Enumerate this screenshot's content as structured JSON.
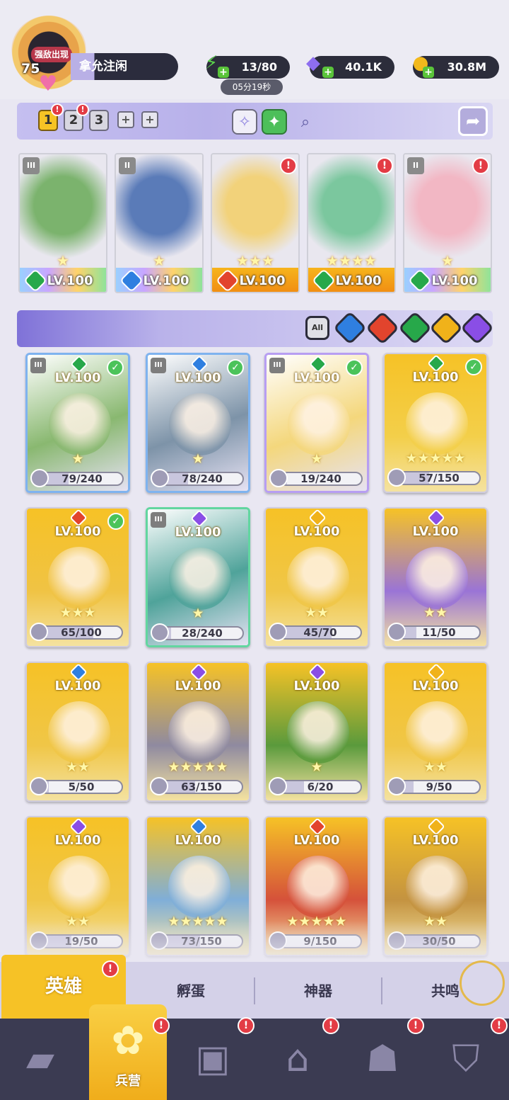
{
  "colors": {
    "nature": "#27a84a",
    "water": "#2f7fe0",
    "fire": "#e2442d",
    "light": "#f0b21a",
    "dark": "#8a4ee6",
    "gold_card": "#f6c226",
    "accent_purple": "#8e83e0"
  },
  "header": {
    "player": {
      "level": "75",
      "alert": "强敌出现",
      "name": "拿允注闲"
    },
    "energy": {
      "icon": "lightning-icon",
      "value": "13/80",
      "timer": "05分19秒"
    },
    "gems": {
      "icon": "diamond-icon",
      "value": "40.1K"
    },
    "coins": {
      "icon": "coin-icon",
      "value": "30.8M"
    }
  },
  "team_bar": {
    "tabs": [
      {
        "label": "1",
        "active": true,
        "alert": "!"
      },
      {
        "label": "2",
        "active": false,
        "alert": "!"
      },
      {
        "label": "3",
        "active": false,
        "alert": ""
      }
    ],
    "add_labels": [
      "+",
      "+"
    ]
  },
  "team": [
    {
      "rank": "III",
      "level": "LV.100",
      "element": "nature",
      "stars": "★",
      "band": "rainbow",
      "art": "#7bb36d",
      "alert": ""
    },
    {
      "rank": "II",
      "level": "LV.100",
      "element": "water",
      "stars": "★",
      "band": "rainbow",
      "art": "#5a7bb8",
      "alert": ""
    },
    {
      "rank": "",
      "level": "LV.100",
      "element": "fire",
      "stars": "★★★",
      "band": "gold",
      "art": "#f2d27a",
      "alert": "!"
    },
    {
      "rank": "",
      "level": "LV.100",
      "element": "nature",
      "stars": "★★★★",
      "band": "gold",
      "art": "#7bc79e",
      "alert": "!"
    },
    {
      "rank": "II",
      "level": "LV.100",
      "element": "nature",
      "stars": "★",
      "band": "rainbow",
      "art": "#f2b7c4",
      "alert": "!"
    }
  ],
  "filters": {
    "all_label": "All",
    "elements": [
      "water",
      "fire",
      "nature",
      "light",
      "dark"
    ]
  },
  "heroes": [
    {
      "rank": "III",
      "level": "LV.100",
      "element": "nature",
      "stars": "★",
      "frag_value": 79,
      "frag_max": 240,
      "fragments": "79/240",
      "owned": "blue",
      "check": true,
      "art": "#89b870"
    },
    {
      "rank": "III",
      "level": "LV.100",
      "element": "water",
      "stars": "★",
      "frag_value": 78,
      "frag_max": 240,
      "fragments": "78/240",
      "owned": "blue",
      "check": true,
      "art": "#7d93a8"
    },
    {
      "rank": "III",
      "level": "LV.100",
      "element": "nature",
      "stars": "★",
      "frag_value": 19,
      "frag_max": 240,
      "fragments": "19/240",
      "owned": "purple",
      "check": true,
      "art": "#f4d77c"
    },
    {
      "rank": "",
      "level": "LV.100",
      "element": "nature",
      "stars": "★★★★★",
      "frag_value": 57,
      "frag_max": 150,
      "fragments": "57/150",
      "owned": "",
      "check": true,
      "art": "#f3cf4a"
    },
    {
      "rank": "",
      "level": "LV.100",
      "element": "fire",
      "stars": "★★★",
      "frag_value": 65,
      "frag_max": 100,
      "fragments": "65/100",
      "owned": "",
      "check": true,
      "art": "#f0c344"
    },
    {
      "rank": "III",
      "level": "LV.100",
      "element": "dark",
      "stars": "★",
      "frag_value": 28,
      "frag_max": 240,
      "fragments": "28/240",
      "owned": "green",
      "check": false,
      "art": "#4fa39a"
    },
    {
      "rank": "",
      "level": "LV.100",
      "element": "light",
      "stars": "★★",
      "frag_value": 45,
      "frag_max": 70,
      "fragments": "45/70",
      "owned": "",
      "check": false,
      "art": "#f0c647"
    },
    {
      "rank": "",
      "level": "LV.100",
      "element": "dark",
      "stars": "★★",
      "frag_value": 11,
      "frag_max": 50,
      "fragments": "11/50",
      "owned": "",
      "check": false,
      "art": "#9a74d6"
    },
    {
      "rank": "",
      "level": "LV.100",
      "element": "water",
      "stars": "★★",
      "frag_value": 5,
      "frag_max": 50,
      "fragments": "5/50",
      "owned": "",
      "check": false,
      "art": "#f0c647"
    },
    {
      "rank": "",
      "level": "LV.100",
      "element": "dark",
      "stars": "★★★★★",
      "frag_value": 63,
      "frag_max": 150,
      "fragments": "63/150",
      "owned": "",
      "check": false,
      "art": "#8f8aa0"
    },
    {
      "rank": "",
      "level": "LV.100",
      "element": "dark",
      "stars": "★",
      "frag_value": 6,
      "frag_max": 20,
      "fragments": "6/20",
      "owned": "",
      "check": false,
      "art": "#5a9a3c"
    },
    {
      "rank": "",
      "level": "LV.100",
      "element": "light",
      "stars": "★★",
      "frag_value": 9,
      "frag_max": 50,
      "fragments": "9/50",
      "owned": "",
      "check": false,
      "art": "#f0c647"
    },
    {
      "rank": "",
      "level": "LV.100",
      "element": "dark",
      "stars": "★★",
      "frag_value": 19,
      "frag_max": 50,
      "fragments": "19/50",
      "owned": "",
      "check": false,
      "art": "#f0c647"
    },
    {
      "rank": "",
      "level": "LV.100",
      "element": "water",
      "stars": "★★★★★",
      "frag_value": 73,
      "frag_max": 150,
      "fragments": "73/150",
      "owned": "",
      "check": false,
      "art": "#7faed8"
    },
    {
      "rank": "",
      "level": "LV.100",
      "element": "fire",
      "stars": "★★★★★",
      "frag_value": 9,
      "frag_max": 150,
      "fragments": "9/150",
      "owned": "",
      "check": false,
      "art": "#d5513a"
    },
    {
      "rank": "",
      "level": "LV.100",
      "element": "light",
      "stars": "★★",
      "frag_value": 30,
      "frag_max": 50,
      "fragments": "30/50",
      "owned": "",
      "check": false,
      "art": "#c49340"
    }
  ],
  "subtabs": {
    "active": "英雄",
    "items": [
      "孵蛋",
      "神器",
      "共鸣"
    ],
    "alert": "!"
  },
  "bottom_nav": {
    "items": [
      {
        "icon": "cards-icon",
        "alert": ""
      },
      {
        "icon": "barracks-icon",
        "alert": "!",
        "label": "兵营",
        "active": true
      },
      {
        "icon": "map-icon",
        "alert": "!"
      },
      {
        "icon": "castle-icon",
        "alert": "!"
      },
      {
        "icon": "guild-icon",
        "alert": "!"
      },
      {
        "icon": "banner-icon",
        "alert": "!"
      }
    ]
  }
}
